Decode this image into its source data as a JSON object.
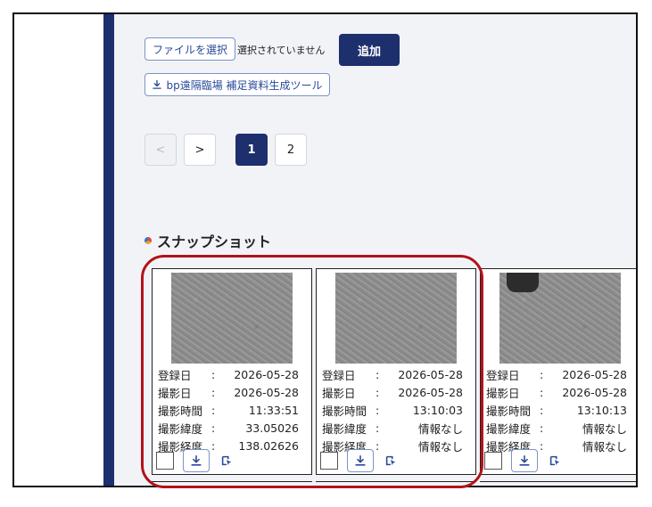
{
  "upload": {
    "file_button": "ファイルを選択",
    "no_file_text": "選択されていません",
    "add_button": "追加",
    "tool_button": "bp遠隔臨場 補足資料生成ツール"
  },
  "pagination": {
    "prev": "<",
    "next": ">",
    "pages": [
      "1",
      "2"
    ],
    "current": "1"
  },
  "section": {
    "title": "スナップショット"
  },
  "labels": {
    "registered": "登録日",
    "taken": "撮影日",
    "time": "撮影時間",
    "lat": "撮影緯度",
    "lng": "撮影経度",
    "sep": ":"
  },
  "cards": [
    {
      "registered": "2026-05-28",
      "taken": "2026-05-28",
      "time": "11:33:51",
      "lat": "33.05026",
      "lng": "138.02626"
    },
    {
      "registered": "2026-05-28",
      "taken": "2026-05-28",
      "time": "13:10:03",
      "lat": "情報なし",
      "lng": "情報なし"
    },
    {
      "registered": "2026-05-28",
      "taken": "2026-05-28",
      "time": "13:10:13",
      "lat": "情報なし",
      "lng": "情報なし"
    }
  ],
  "colors": {
    "primary": "#1e2f6e",
    "highlight": "#b3121a",
    "outline": "#7d93c8"
  }
}
